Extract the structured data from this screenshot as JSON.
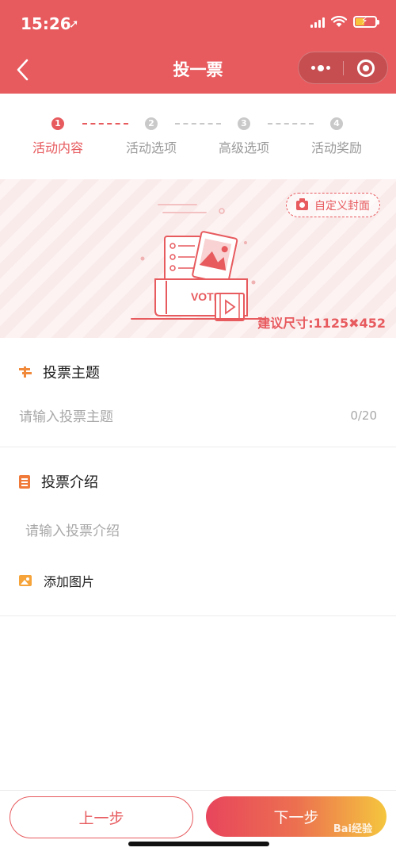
{
  "status_bar": {
    "time": "15:26",
    "location_glyph": "➚",
    "battery_fraction": 0.45
  },
  "nav": {
    "back_icon": "chevron-left-icon",
    "title": "投一票",
    "more_icon": "more-dots-icon",
    "close_icon": "target-close-icon"
  },
  "steps": [
    {
      "number": "1",
      "label": "活动内容",
      "active": true
    },
    {
      "number": "2",
      "label": "活动选项",
      "active": false
    },
    {
      "number": "3",
      "label": "高级选项",
      "active": false
    },
    {
      "number": "4",
      "label": "活动奖励",
      "active": false
    }
  ],
  "banner": {
    "custom_cover_label": "自定义封面",
    "size_hint": "建议尺寸:1125✖452",
    "illustration_text": "VOTE"
  },
  "topic_section": {
    "title": "投票主题",
    "placeholder": "请输入投票主题",
    "counter": "0/20"
  },
  "intro_section": {
    "title": "投票介绍",
    "placeholder": "请输入投票介绍"
  },
  "add_picture": {
    "label": "添加图片"
  },
  "footer": {
    "prev_label": "上一步",
    "next_label": "下一步",
    "watermark": "Bai经验"
  },
  "colors": {
    "accent": "#e75a5e",
    "gradient_start": "#e8455c",
    "gradient_end": "#f5c63e",
    "icon_orange": "#f08a3a"
  }
}
